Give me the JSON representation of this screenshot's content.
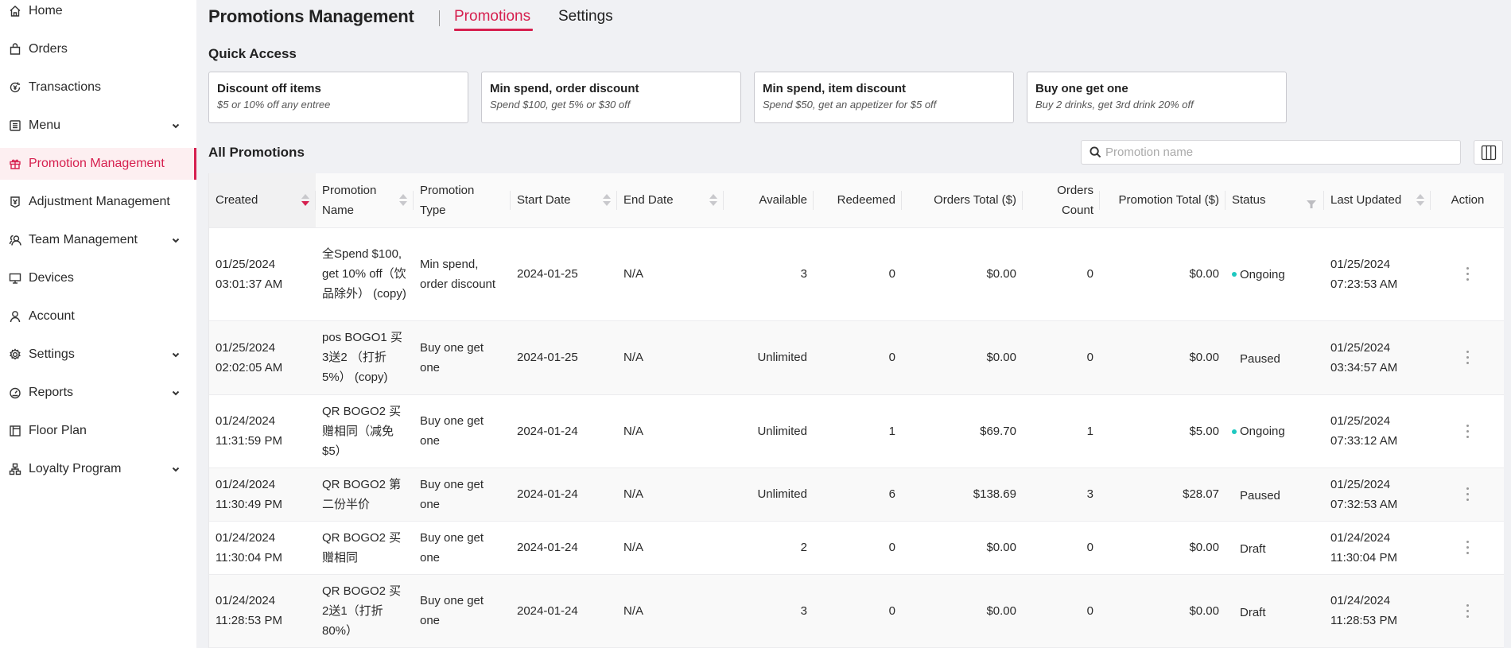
{
  "sidebar": {
    "items": [
      {
        "label": "Home",
        "icon": "home-icon",
        "has_chevron": false,
        "active": false
      },
      {
        "label": "Orders",
        "icon": "bag-icon",
        "has_chevron": false,
        "active": false
      },
      {
        "label": "Transactions",
        "icon": "transactions-icon",
        "has_chevron": false,
        "active": false
      },
      {
        "label": "Menu",
        "icon": "menu-list-icon",
        "has_chevron": true,
        "active": false
      },
      {
        "label": "Promotion Management",
        "icon": "gift-icon",
        "has_chevron": false,
        "active": true
      },
      {
        "label": "Adjustment Management",
        "icon": "adjustment-icon",
        "has_chevron": false,
        "active": false
      },
      {
        "label": "Team Management",
        "icon": "team-icon",
        "has_chevron": true,
        "active": false
      },
      {
        "label": "Devices",
        "icon": "monitor-icon",
        "has_chevron": false,
        "active": false
      },
      {
        "label": "Account",
        "icon": "user-icon",
        "has_chevron": false,
        "active": false
      },
      {
        "label": "Settings",
        "icon": "gear-icon",
        "has_chevron": true,
        "active": false
      },
      {
        "label": "Reports",
        "icon": "gauge-icon",
        "has_chevron": true,
        "active": false
      },
      {
        "label": "Floor Plan",
        "icon": "floor-plan-icon",
        "has_chevron": false,
        "active": false
      },
      {
        "label": "Loyalty Program",
        "icon": "hierarchy-icon",
        "has_chevron": true,
        "active": false
      }
    ]
  },
  "header": {
    "title": "Promotions Management",
    "tabs": [
      {
        "label": "Promotions",
        "active": true
      },
      {
        "label": "Settings",
        "active": false
      }
    ]
  },
  "quick_access": {
    "title": "Quick Access",
    "cards": [
      {
        "title": "Discount off items",
        "subtitle": "$5 or 10% off any entree"
      },
      {
        "title": "Min spend, order discount",
        "subtitle": "Spend $100, get 5% or $30 off"
      },
      {
        "title": "Min spend, item discount",
        "subtitle": "Spend $50, get an appetizer for $5 off"
      },
      {
        "title": "Buy one get one",
        "subtitle": "Buy 2 drinks, get 3rd drink 20% off"
      }
    ]
  },
  "all_promotions": {
    "title": "All Promotions",
    "search_placeholder": "Promotion name",
    "search_value": "",
    "columns": [
      {
        "label": "Created",
        "sortable": true,
        "sort": "desc"
      },
      {
        "label": "Promotion Name",
        "sortable": true
      },
      {
        "label": "Promotion Type",
        "sortable": false
      },
      {
        "label": "Start Date",
        "sortable": true
      },
      {
        "label": "End Date",
        "sortable": true
      },
      {
        "label": "Available",
        "sortable": false
      },
      {
        "label": "Redeemed",
        "sortable": false
      },
      {
        "label": "Orders Total ($)",
        "sortable": false
      },
      {
        "label": "Orders Count",
        "sortable": false
      },
      {
        "label": "Promotion Total ($)",
        "sortable": false
      },
      {
        "label": "Status",
        "filterable": true
      },
      {
        "label": "Last Updated",
        "sortable": true
      },
      {
        "label": "Action",
        "sortable": false
      }
    ],
    "rows": [
      {
        "created_date": "01/25/2024",
        "created_time": "03:01:37 AM",
        "name": "全Spend $100, get 10% off（饮品除外） (copy)",
        "type": "Min spend, order discount",
        "start": "2024-01-25",
        "end": "N/A",
        "available": "3",
        "redeemed": "0",
        "orders_total": "$0.00",
        "orders_count": "0",
        "promo_total": "$0.00",
        "status": "Ongoing",
        "updated_date": "01/25/2024",
        "updated_time": "07:23:53 AM"
      },
      {
        "created_date": "01/25/2024",
        "created_time": "02:02:05 AM",
        "name": "pos BOGO1 买3送2 （打折5%） (copy)",
        "type": "Buy one get one",
        "start": "2024-01-25",
        "end": "N/A",
        "available": "Unlimited",
        "redeemed": "0",
        "orders_total": "$0.00",
        "orders_count": "0",
        "promo_total": "$0.00",
        "status": "Paused",
        "updated_date": "01/25/2024",
        "updated_time": "03:34:57 AM"
      },
      {
        "created_date": "01/24/2024",
        "created_time": "11:31:59 PM",
        "name": "QR BOGO2 买赠相同（减免$5）",
        "type": "Buy one get one",
        "start": "2024-01-24",
        "end": "N/A",
        "available": "Unlimited",
        "redeemed": "1",
        "orders_total": "$69.70",
        "orders_count": "1",
        "promo_total": "$5.00",
        "status": "Ongoing",
        "updated_date": "01/25/2024",
        "updated_time": "07:33:12 AM"
      },
      {
        "created_date": "01/24/2024",
        "created_time": "11:30:49 PM",
        "name": "QR BOGO2 第二份半价",
        "type": "Buy one get one",
        "start": "2024-01-24",
        "end": "N/A",
        "available": "Unlimited",
        "redeemed": "6",
        "orders_total": "$138.69",
        "orders_count": "3",
        "promo_total": "$28.07",
        "status": "Paused",
        "updated_date": "01/25/2024",
        "updated_time": "07:32:53 AM"
      },
      {
        "created_date": "01/24/2024",
        "created_time": "11:30:04 PM",
        "name": "QR BOGO2 买赠相同",
        "type": "Buy one get one",
        "start": "2024-01-24",
        "end": "N/A",
        "available": "2",
        "redeemed": "0",
        "orders_total": "$0.00",
        "orders_count": "0",
        "promo_total": "$0.00",
        "status": "Draft",
        "updated_date": "01/24/2024",
        "updated_time": "11:30:04 PM"
      },
      {
        "created_date": "01/24/2024",
        "created_time": "11:28:53 PM",
        "name": "QR BOGO2 买2送1（打折80%）",
        "type": "Buy one get one",
        "start": "2024-01-24",
        "end": "N/A",
        "available": "3",
        "redeemed": "0",
        "orders_total": "$0.00",
        "orders_count": "0",
        "promo_total": "$0.00",
        "status": "Draft",
        "updated_date": "01/24/2024",
        "updated_time": "11:28:53 PM"
      }
    ]
  },
  "colors": {
    "accent": "#d6204f",
    "active_bg": "#fdeff1",
    "ongoing_dot": "#1ec8c0",
    "page_bg": "#f0f1f4"
  }
}
